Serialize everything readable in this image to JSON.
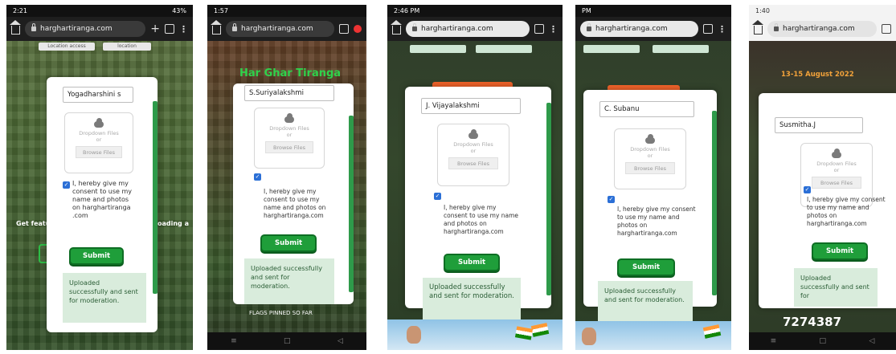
{
  "screens": [
    {
      "status_time": "2:21",
      "status_right": "43%",
      "url": "harghartiranga.com",
      "top_buttons": [
        "Location access",
        "location"
      ],
      "name_value": "Yogadharshini s",
      "dropzone_text": "Dropdown Files",
      "dropzone_or": "or",
      "browse_label": "Browse Files",
      "consent_text": "I, hereby give my consent to use my name and photos on harghartiranga .com",
      "submit_label": "Submit",
      "success_text": "Uploaded successfully and sent for moderation.",
      "side_left": "Get featu",
      "side_right": "oading a"
    },
    {
      "status_time": "1:57",
      "url": "harghartiranga.com",
      "heading": "Har Ghar Tiranga",
      "name_value": "S.Suriyalakshmi",
      "dropzone_text": "Dropdown Files",
      "dropzone_or": "or",
      "browse_label": "Browse Files",
      "consent_text": "I, hereby give my consent to use my name and photos on harghartiranga.com",
      "submit_label": "Submit",
      "success_text": "Uploaded successfully and sent for moderation.",
      "flags_pinned": "FLAGS PINNED SO FAR"
    },
    {
      "status_time": "2:46 PM",
      "url": "harghartiranga.com",
      "name_value": "J. Vijayalakshmi",
      "dropzone_text": "Dropdown Files",
      "dropzone_or": "or",
      "browse_label": "Browse Files",
      "consent_text": "I, hereby give my consent to use my name and photos on harghartiranga.com",
      "submit_label": "Submit",
      "success_text": "Uploaded successfully and sent for moderation."
    },
    {
      "status_time": "PM",
      "url": "harghartiranga.com",
      "name_value": "C. Subanu",
      "dropzone_text": "Dropdown Files",
      "dropzone_or": "or",
      "browse_label": "Browse Files",
      "consent_text": "I, hereby give my consent to use my name and photos on harghartiranga.com",
      "submit_label": "Submit",
      "success_text": "Uploaded successfully and sent for moderation."
    },
    {
      "status_time": "1:40",
      "url": "harghartiranga.com",
      "date_text": "13-15 August 2022",
      "name_value": "Susmitha.J",
      "dropzone_text": "Dropdown Files",
      "dropzone_or": "or",
      "browse_label": "Browse Files",
      "consent_text": "I, hereby give my consent to use my name and photos on harghartiranga.com",
      "submit_label": "Submit",
      "success_text": "Uploaded successfully and sent for",
      "counter": "7274387"
    }
  ],
  "colors": {
    "submit_green": "#1f9e3a",
    "success_bg": "#d9ecdc",
    "checkbox_blue": "#2b6fd6",
    "heading_green": "#2fd24b",
    "scrollbar_green": "#2e9a4a"
  }
}
